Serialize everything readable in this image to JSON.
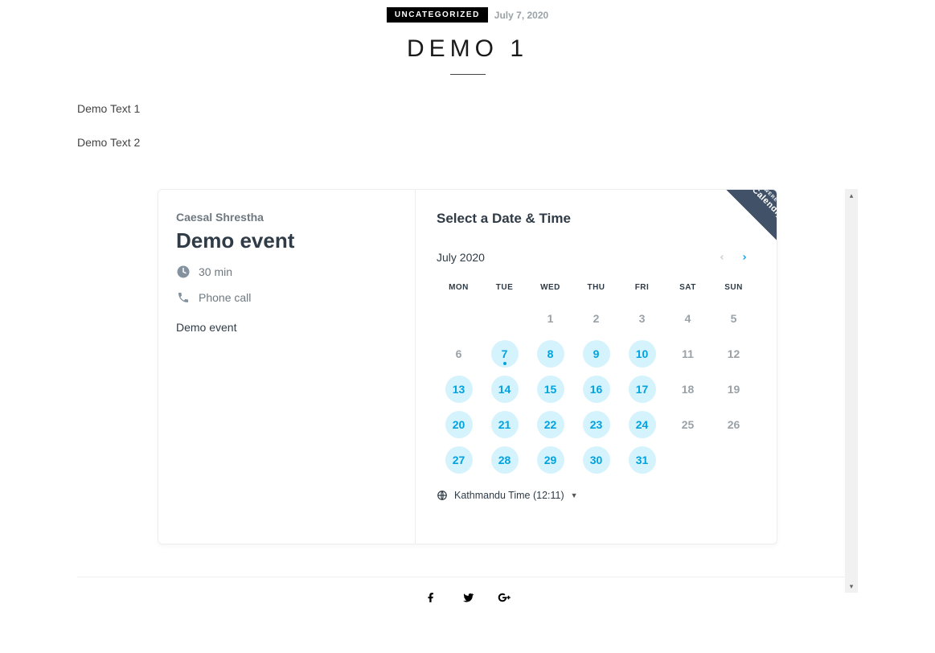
{
  "post": {
    "category": "UNCATEGORIZED",
    "date": "July 7, 2020",
    "title": "DEMO 1",
    "paragraphs": [
      "Demo Text 1",
      "Demo Text 2"
    ]
  },
  "calendly": {
    "host": "Caesal Shrestha",
    "event_name": "Demo event",
    "duration": "30 min",
    "location": "Phone call",
    "description": "Demo event",
    "right_title": "Select a Date & Time",
    "month_label": "July 2020",
    "ribbon_small": "POWERED BY",
    "ribbon_big": "Calendly",
    "timezone": "Kathmandu Time (12:11)",
    "dow": [
      "MON",
      "TUE",
      "WED",
      "THU",
      "FRI",
      "SAT",
      "SUN"
    ],
    "days": [
      {
        "n": "",
        "state": "blank"
      },
      {
        "n": "",
        "state": "blank"
      },
      {
        "n": "1",
        "state": "past"
      },
      {
        "n": "2",
        "state": "past"
      },
      {
        "n": "3",
        "state": "past"
      },
      {
        "n": "4",
        "state": "past"
      },
      {
        "n": "5",
        "state": "past"
      },
      {
        "n": "6",
        "state": "past"
      },
      {
        "n": "7",
        "state": "avail",
        "today": true
      },
      {
        "n": "8",
        "state": "avail"
      },
      {
        "n": "9",
        "state": "avail"
      },
      {
        "n": "10",
        "state": "avail"
      },
      {
        "n": "11",
        "state": "unavail"
      },
      {
        "n": "12",
        "state": "unavail"
      },
      {
        "n": "13",
        "state": "avail"
      },
      {
        "n": "14",
        "state": "avail"
      },
      {
        "n": "15",
        "state": "avail"
      },
      {
        "n": "16",
        "state": "avail"
      },
      {
        "n": "17",
        "state": "avail"
      },
      {
        "n": "18",
        "state": "unavail"
      },
      {
        "n": "19",
        "state": "unavail"
      },
      {
        "n": "20",
        "state": "avail"
      },
      {
        "n": "21",
        "state": "avail"
      },
      {
        "n": "22",
        "state": "avail"
      },
      {
        "n": "23",
        "state": "avail"
      },
      {
        "n": "24",
        "state": "avail"
      },
      {
        "n": "25",
        "state": "unavail"
      },
      {
        "n": "26",
        "state": "unavail"
      },
      {
        "n": "27",
        "state": "avail"
      },
      {
        "n": "28",
        "state": "avail"
      },
      {
        "n": "29",
        "state": "avail"
      },
      {
        "n": "30",
        "state": "avail"
      },
      {
        "n": "31",
        "state": "avail"
      },
      {
        "n": "",
        "state": "blank"
      },
      {
        "n": "",
        "state": "blank"
      }
    ]
  }
}
